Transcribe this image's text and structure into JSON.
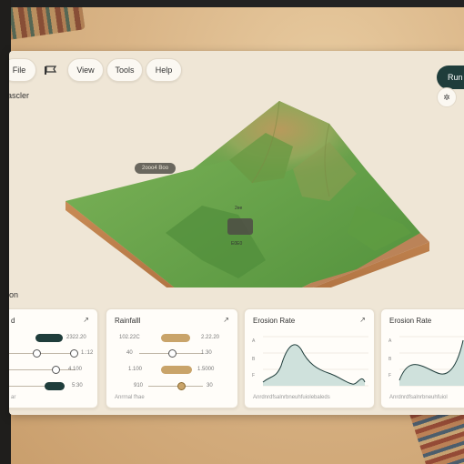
{
  "toolbar": {
    "file": "File",
    "view": "View",
    "tools": "Tools",
    "help": "Help",
    "run": "Run"
  },
  "canvas": {
    "label": "ascler",
    "section_label": "ion",
    "tooltip": "2ooo4 Boo",
    "coord_label": "2ee",
    "marker_label": "E0E0"
  },
  "cards": {
    "card1": {
      "title": "d",
      "rows": [
        {
          "left": "",
          "right": "2322.20"
        },
        {
          "left": "",
          "right": "1.:12"
        },
        {
          "left": "",
          "right": "4.100"
        },
        {
          "left": "",
          "right": "5:30"
        }
      ],
      "footer": "ar"
    },
    "card2": {
      "title": "Rainfalll",
      "rows": [
        {
          "left": "102.22C",
          "right": "2.22.20"
        },
        {
          "left": "40",
          "right": "1.30"
        },
        {
          "left": "1.100",
          "right": "1.5000"
        },
        {
          "left": "910",
          "right": "30"
        }
      ],
      "footer": "Anrrnal fhae"
    },
    "card3": {
      "title": "Erosion Rate",
      "ylabels": [
        "A",
        "B",
        "F"
      ],
      "footer": "Anrdnrdfsalnrbneuhfuiolebaleds"
    },
    "card4": {
      "title": "Erosion Rate",
      "ylabels": [
        "A",
        "B",
        "F"
      ],
      "footer": "Anrdnrdfsalnrbneuhfuiol"
    }
  },
  "colors": {
    "accent_dark": "#1f3d3b",
    "accent_tan": "#c9a46a",
    "chart_fill": "#cfe1dc",
    "chart_line": "#1f3d3b"
  }
}
